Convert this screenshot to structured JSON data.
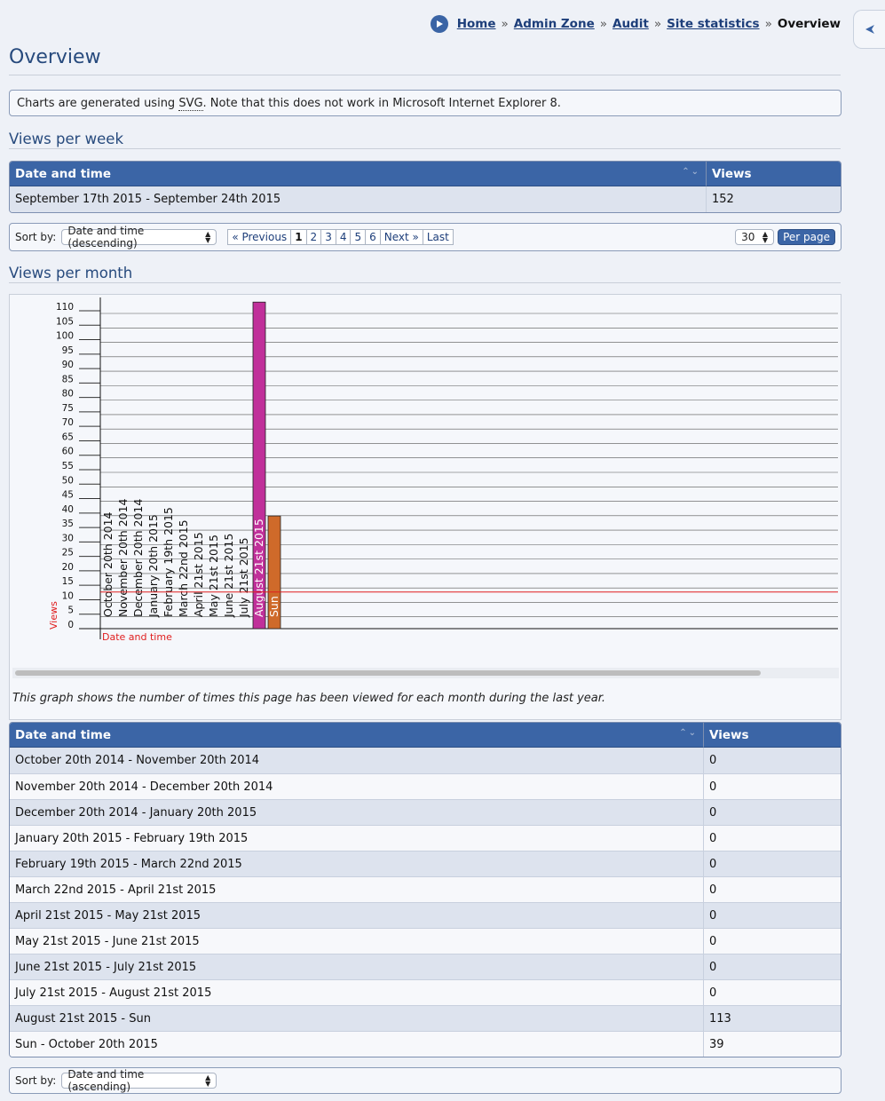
{
  "breadcrumb": {
    "items": [
      "Home",
      "Admin Zone",
      "Audit",
      "Site statistics"
    ],
    "separator": "»",
    "current": "Overview"
  },
  "page_title": "Overview",
  "notice": {
    "before": "Charts are generated using ",
    "abbr": "SVG",
    "after": ". Note that this does not work in Microsoft Internet Explorer 8."
  },
  "weekly": {
    "heading": "Views per week",
    "columns": [
      "Date and time",
      "Views"
    ],
    "rows": [
      {
        "date": "September 17th 2015 - September 24th 2015",
        "views": "152"
      }
    ],
    "sort_label": "Sort by:",
    "sort_value": "Date and time (descending)",
    "pagination": [
      "« Previous",
      "1",
      "2",
      "3",
      "4",
      "5",
      "6",
      "Next »",
      "Last"
    ],
    "current_page": "1",
    "per_page_value": "30",
    "per_page_button": "Per page"
  },
  "monthly": {
    "heading": "Views per month",
    "caption": "This graph shows the number of times this page has been viewed for each month during the last year.",
    "columns": [
      "Date and time",
      "Views"
    ],
    "rows": [
      {
        "date": "October 20th 2014 - November 20th 2014",
        "views": "0"
      },
      {
        "date": "November 20th 2014 - December 20th 2014",
        "views": "0"
      },
      {
        "date": "December 20th 2014 - January 20th 2015",
        "views": "0"
      },
      {
        "date": "January 20th 2015 - February 19th 2015",
        "views": "0"
      },
      {
        "date": "February 19th 2015 - March 22nd 2015",
        "views": "0"
      },
      {
        "date": "March 22nd 2015 - April 21st 2015",
        "views": "0"
      },
      {
        "date": "April 21st 2015 - May 21st 2015",
        "views": "0"
      },
      {
        "date": "May 21st 2015 - June 21st 2015",
        "views": "0"
      },
      {
        "date": "June 21st 2015 - July 21st 2015",
        "views": "0"
      },
      {
        "date": "July 21st 2015 - August 21st 2015",
        "views": "0"
      },
      {
        "date": "August 21st 2015 - Sun",
        "views": "113"
      },
      {
        "date": "Sun - October 20th 2015",
        "views": "39"
      }
    ],
    "sort_label": "Sort by:",
    "sort_value": "Date and time (ascending)"
  },
  "chart_data": {
    "type": "bar",
    "categories": [
      "October 20th 2014",
      "November 20th 2014",
      "December 20th 2014",
      "January 20th 2015",
      "February 19th 2015",
      "March 22nd 2015",
      "April 21st 2015",
      "May 21st 2015",
      "June 21st 2015",
      "July 21st 2015",
      "August 21st 2015",
      "Sun"
    ],
    "values": [
      0,
      0,
      0,
      0,
      0,
      0,
      0,
      0,
      0,
      0,
      113,
      39
    ],
    "bar_colors": [
      "#c0309a",
      "#cf6a2a"
    ],
    "average_line_color": "#e01e1e",
    "average_value": 12.67,
    "xlabel": "Date and time",
    "ylabel": "Views",
    "ylim": [
      0,
      110
    ],
    "yticks": [
      0,
      5,
      10,
      15,
      20,
      25,
      30,
      35,
      40,
      45,
      50,
      55,
      60,
      65,
      70,
      75,
      80,
      85,
      90,
      95,
      100,
      105,
      110
    ],
    "grid": true
  },
  "colors": {
    "header_blue": "#3b65a6",
    "title_blue": "#274a7d",
    "row_alt": "#dde3ee"
  }
}
